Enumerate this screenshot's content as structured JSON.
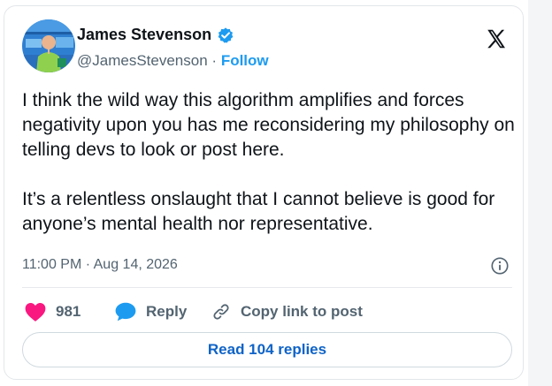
{
  "author": {
    "name": "James Stevenson",
    "handle": "@JamesStevenson",
    "separator": "·",
    "follow_label": "Follow",
    "verified_icon": "verified-badge-icon",
    "verified_color": "#1d9bf0"
  },
  "tweet": {
    "paragraphs": [
      "I think the wild way this algorithm amplifies and forces negativity upon you has me reconsidering my philosophy on telling devs to look or post here.",
      "It’s a relentless onslaught that I cannot believe is good for anyone’s mental health nor representative."
    ],
    "timestamp": "11:00 PM · Aug 14, 2026"
  },
  "actions": {
    "likes_count": "981",
    "reply_label": "Reply",
    "copy_link_label": "Copy link to post",
    "read_replies_label": "Read 104 replies"
  },
  "icons": {
    "platform_logo": "x-logo-icon",
    "info": "info-icon",
    "like": "heart-icon",
    "reply": "speech-bubble-icon",
    "copy": "link-icon"
  },
  "colors": {
    "like": "#f91880",
    "reply": "#1d9bf0",
    "follow": "#1d9bf0",
    "read_replies_text": "#0f63c7",
    "text_primary": "#0f1419",
    "text_secondary": "#536471"
  }
}
